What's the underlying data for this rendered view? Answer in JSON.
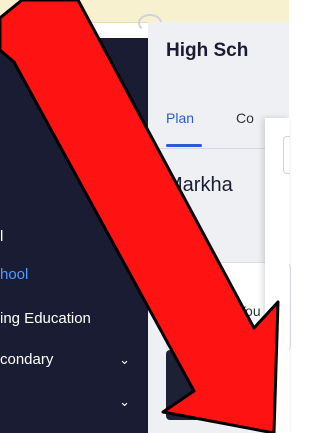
{
  "sidebar": {
    "items": [
      {
        "label": "l",
        "active": false,
        "has_chevron": false
      },
      {
        "label": "hool",
        "active": true,
        "has_chevron": false
      },
      {
        "label": "ing Education",
        "active": false,
        "has_chevron": false
      },
      {
        "label": "condary",
        "active": false,
        "has_chevron": true
      },
      {
        "label": "",
        "active": false,
        "has_chevron": true
      }
    ]
  },
  "main": {
    "title": "High Sch",
    "tabs": [
      {
        "label": "Plan",
        "active": true
      },
      {
        "label": "Co"
      }
    ],
    "location": "Markha",
    "info_card_text": "You"
  },
  "overlay": {
    "arrow_color": "#ff0000",
    "arrow_icon": "red-arrow-pointing-down-right"
  },
  "colors": {
    "sidebar_bg": "#1a1c33",
    "active_link": "#4d9bff",
    "tab_accent": "#2a5bd7",
    "banner_bg": "#f8f1cf"
  }
}
